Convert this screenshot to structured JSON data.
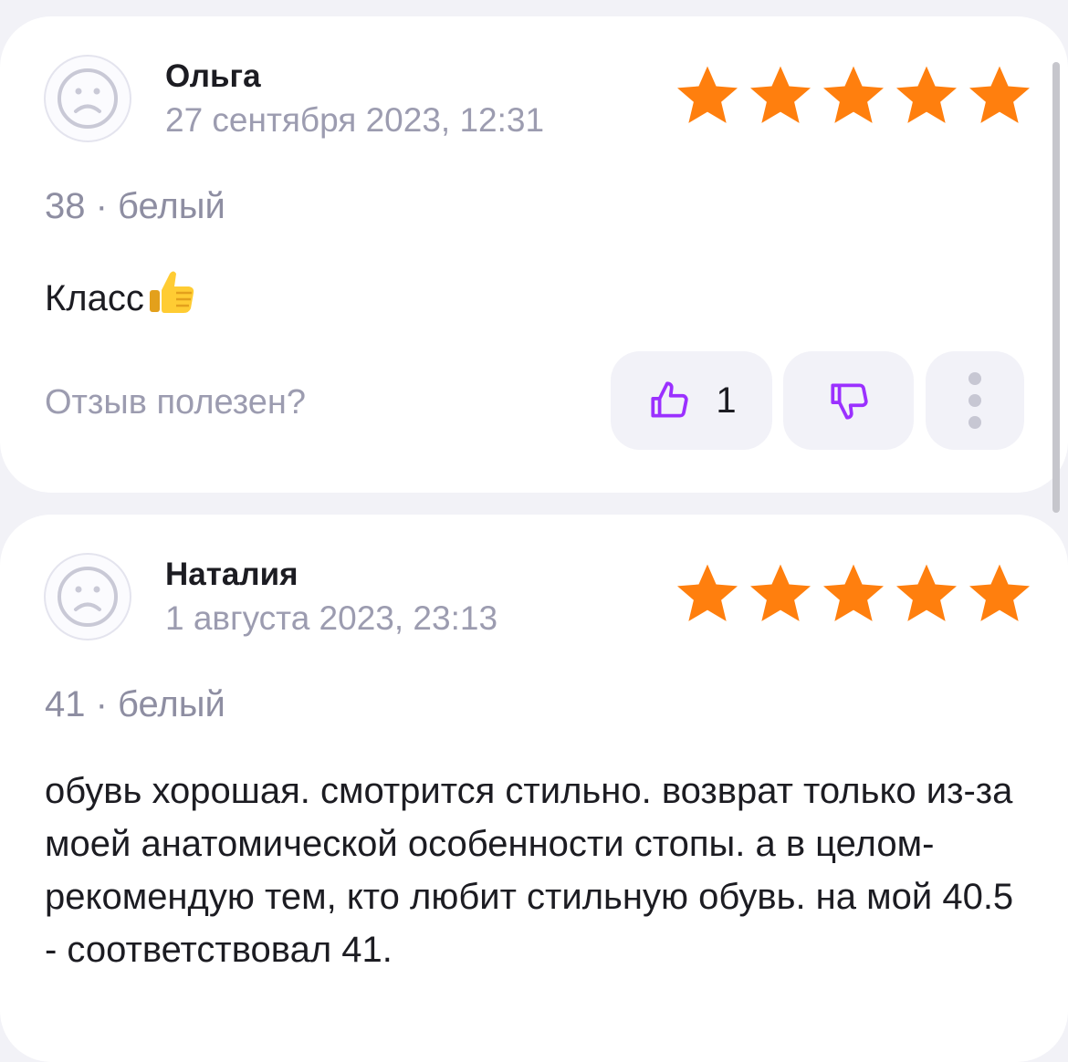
{
  "reviews": [
    {
      "author": "Ольга",
      "date": "27 сентября 2023, 12:31",
      "rating": 5,
      "variant": "38 · белый",
      "text": "Класс",
      "text_emoji": "thumbs-up-emoji",
      "helpful_label": "Отзыв полезен?",
      "likes": "1"
    },
    {
      "author": "Наталия",
      "date": "1 августа 2023, 23:13",
      "rating": 5,
      "variant": "41 · белый",
      "text": "обувь хорошая. смотрится стильно. возврат только из-за моей анатомической особенности стопы. а в целом- рекомендую тем, кто любит стильную обувь. на мой 40.5 - соответствовал 41."
    }
  ],
  "icons": {
    "avatar": "sad-face-icon",
    "star": "star-icon",
    "like": "thumbs-up-icon",
    "dislike": "thumbs-down-icon",
    "more": "more-vertical-icon"
  },
  "colors": {
    "star": "#ff7f0e",
    "vote_icon": "#9b30ff",
    "secondary_text": "#9c9cb0",
    "card_bg": "#ffffff",
    "page_bg": "#f2f2f7"
  }
}
